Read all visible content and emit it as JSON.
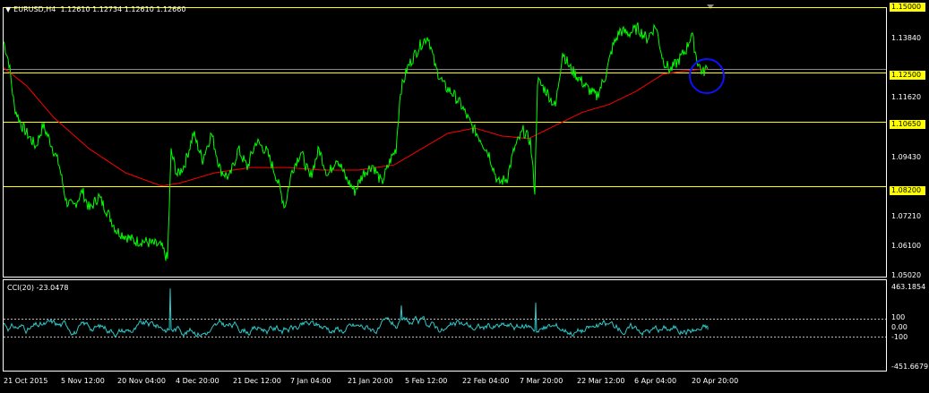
{
  "header": {
    "symbol_label": "EURUSD,H4",
    "ohlc": "1.12610 1.12734 1.12610 1.12660"
  },
  "cci_panel": {
    "label": "CCI(20) -23.0478"
  },
  "colors": {
    "background": "#000000",
    "price_line": "#00ff00",
    "moving_average": "#ff0000",
    "level_lines": "#ffff00",
    "cci_line": "#30c8c8",
    "marker_circle": "#1010ff",
    "grid_border": "#ffffff"
  },
  "chart_data": [
    {
      "type": "line",
      "title": "EURUSD,H4",
      "series": [],
      "y_axis_ticks": [
        "1.13840",
        "1.11620",
        "1.09430",
        "1.07210",
        "1.06100",
        "1.05020"
      ],
      "highlighted_levels": [
        "1.15000",
        "1.12500",
        "1.10650",
        "1.08200"
      ],
      "ylim": [
        1.0502,
        1.154
      ],
      "grid": false
    },
    {
      "type": "line",
      "title": "CCI(20) -23.0478",
      "y_axis_ticks": [
        "463.1854",
        "100",
        "0.00",
        "-100",
        "-451.6679"
      ],
      "ylim": [
        -451.6679,
        463.1854
      ]
    }
  ],
  "x_axis_ticks": [
    "21 Oct 2015",
    "5 Nov 12:00",
    "20 Nov 04:00",
    "4 Dec 20:00",
    "21 Dec 12:00",
    "7 Jan 04:00",
    "21 Jan 20:00",
    "5 Feb 12:00",
    "22 Feb 04:00",
    "7 Mar 20:00",
    "22 Mar 12:00",
    "6 Apr 04:00",
    "20 Apr 20:00"
  ]
}
